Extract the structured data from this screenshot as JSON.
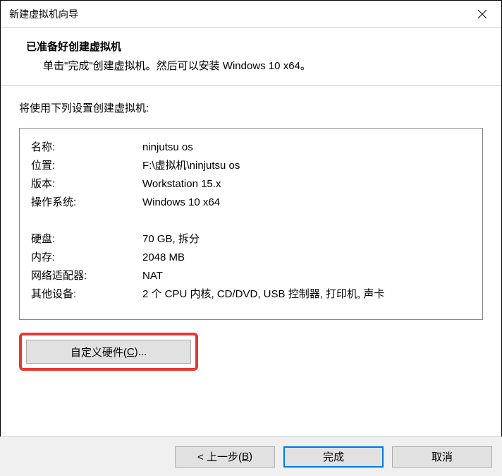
{
  "titlebar": {
    "title": "新建虚拟机向导"
  },
  "header": {
    "title": "已准备好创建虚拟机",
    "subtitle": "单击\"完成\"创建虚拟机。然后可以安装 Windows 10 x64。"
  },
  "intro": "将使用下列设置创建虚拟机:",
  "settings": [
    {
      "label": "名称:",
      "value": "ninjutsu os"
    },
    {
      "label": "位置:",
      "value": "F:\\虚拟机\\ninjutsu os"
    },
    {
      "label": "版本:",
      "value": "Workstation 15.x"
    },
    {
      "label": "操作系统:",
      "value": "Windows 10 x64"
    }
  ],
  "settings2": [
    {
      "label": "硬盘:",
      "value": "70 GB, 拆分"
    },
    {
      "label": "内存:",
      "value": "2048 MB"
    },
    {
      "label": "网络适配器:",
      "value": "NAT"
    },
    {
      "label": "其他设备:",
      "value": "2 个 CPU 内核, CD/DVD, USB 控制器, 打印机, 声卡"
    }
  ],
  "customize": {
    "prefix": "自定义硬件(",
    "hotkey": "C",
    "suffix": ")..."
  },
  "footer": {
    "back": {
      "prefix": "< 上一步(",
      "hotkey": "B",
      "suffix": ")"
    },
    "finish": "完成",
    "cancel": "取消"
  }
}
